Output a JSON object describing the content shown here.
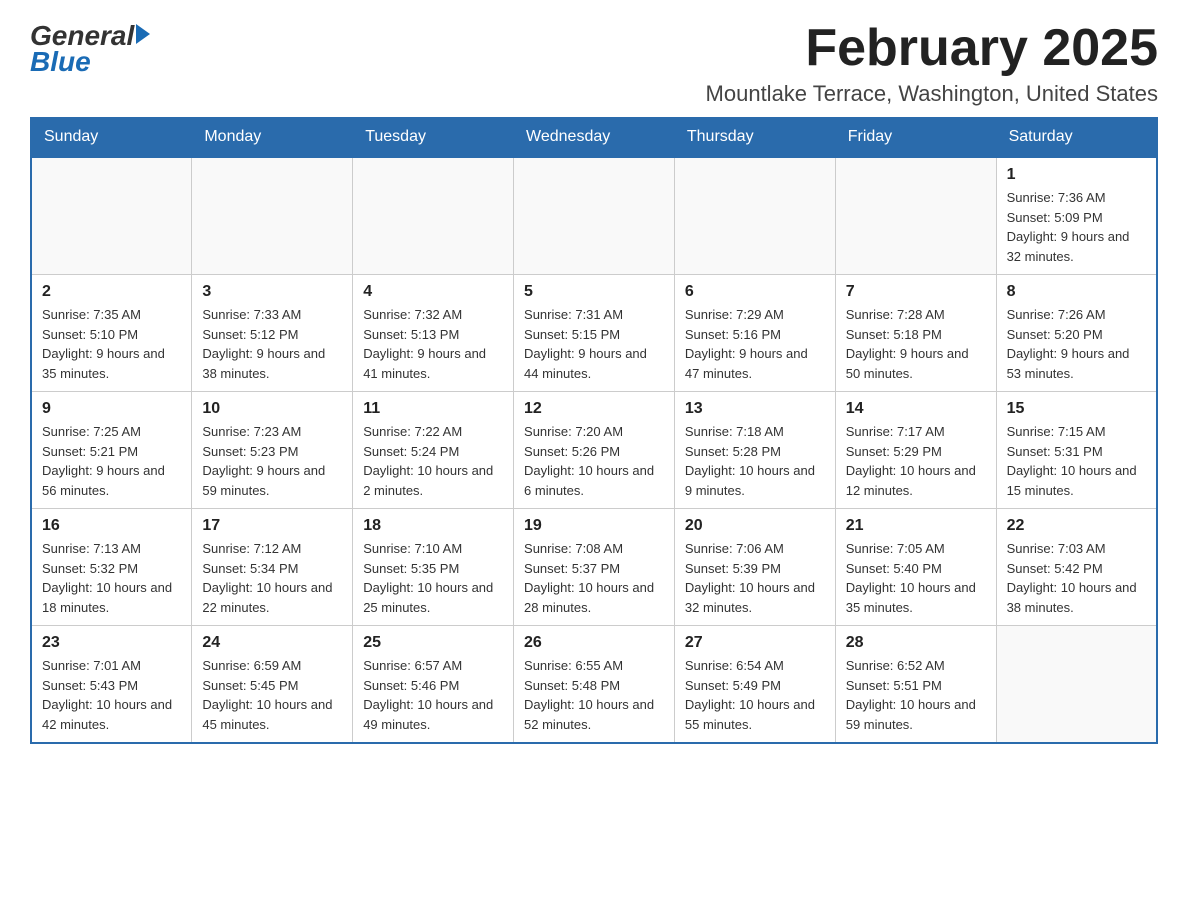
{
  "header": {
    "logo_general": "General",
    "logo_blue": "Blue",
    "month_title": "February 2025",
    "location": "Mountlake Terrace, Washington, United States"
  },
  "weekdays": [
    "Sunday",
    "Monday",
    "Tuesday",
    "Wednesday",
    "Thursday",
    "Friday",
    "Saturday"
  ],
  "weeks": [
    [
      {
        "day": "",
        "info": ""
      },
      {
        "day": "",
        "info": ""
      },
      {
        "day": "",
        "info": ""
      },
      {
        "day": "",
        "info": ""
      },
      {
        "day": "",
        "info": ""
      },
      {
        "day": "",
        "info": ""
      },
      {
        "day": "1",
        "info": "Sunrise: 7:36 AM\nSunset: 5:09 PM\nDaylight: 9 hours and 32 minutes."
      }
    ],
    [
      {
        "day": "2",
        "info": "Sunrise: 7:35 AM\nSunset: 5:10 PM\nDaylight: 9 hours and 35 minutes."
      },
      {
        "day": "3",
        "info": "Sunrise: 7:33 AM\nSunset: 5:12 PM\nDaylight: 9 hours and 38 minutes."
      },
      {
        "day": "4",
        "info": "Sunrise: 7:32 AM\nSunset: 5:13 PM\nDaylight: 9 hours and 41 minutes."
      },
      {
        "day": "5",
        "info": "Sunrise: 7:31 AM\nSunset: 5:15 PM\nDaylight: 9 hours and 44 minutes."
      },
      {
        "day": "6",
        "info": "Sunrise: 7:29 AM\nSunset: 5:16 PM\nDaylight: 9 hours and 47 minutes."
      },
      {
        "day": "7",
        "info": "Sunrise: 7:28 AM\nSunset: 5:18 PM\nDaylight: 9 hours and 50 minutes."
      },
      {
        "day": "8",
        "info": "Sunrise: 7:26 AM\nSunset: 5:20 PM\nDaylight: 9 hours and 53 minutes."
      }
    ],
    [
      {
        "day": "9",
        "info": "Sunrise: 7:25 AM\nSunset: 5:21 PM\nDaylight: 9 hours and 56 minutes."
      },
      {
        "day": "10",
        "info": "Sunrise: 7:23 AM\nSunset: 5:23 PM\nDaylight: 9 hours and 59 minutes."
      },
      {
        "day": "11",
        "info": "Sunrise: 7:22 AM\nSunset: 5:24 PM\nDaylight: 10 hours and 2 minutes."
      },
      {
        "day": "12",
        "info": "Sunrise: 7:20 AM\nSunset: 5:26 PM\nDaylight: 10 hours and 6 minutes."
      },
      {
        "day": "13",
        "info": "Sunrise: 7:18 AM\nSunset: 5:28 PM\nDaylight: 10 hours and 9 minutes."
      },
      {
        "day": "14",
        "info": "Sunrise: 7:17 AM\nSunset: 5:29 PM\nDaylight: 10 hours and 12 minutes."
      },
      {
        "day": "15",
        "info": "Sunrise: 7:15 AM\nSunset: 5:31 PM\nDaylight: 10 hours and 15 minutes."
      }
    ],
    [
      {
        "day": "16",
        "info": "Sunrise: 7:13 AM\nSunset: 5:32 PM\nDaylight: 10 hours and 18 minutes."
      },
      {
        "day": "17",
        "info": "Sunrise: 7:12 AM\nSunset: 5:34 PM\nDaylight: 10 hours and 22 minutes."
      },
      {
        "day": "18",
        "info": "Sunrise: 7:10 AM\nSunset: 5:35 PM\nDaylight: 10 hours and 25 minutes."
      },
      {
        "day": "19",
        "info": "Sunrise: 7:08 AM\nSunset: 5:37 PM\nDaylight: 10 hours and 28 minutes."
      },
      {
        "day": "20",
        "info": "Sunrise: 7:06 AM\nSunset: 5:39 PM\nDaylight: 10 hours and 32 minutes."
      },
      {
        "day": "21",
        "info": "Sunrise: 7:05 AM\nSunset: 5:40 PM\nDaylight: 10 hours and 35 minutes."
      },
      {
        "day": "22",
        "info": "Sunrise: 7:03 AM\nSunset: 5:42 PM\nDaylight: 10 hours and 38 minutes."
      }
    ],
    [
      {
        "day": "23",
        "info": "Sunrise: 7:01 AM\nSunset: 5:43 PM\nDaylight: 10 hours and 42 minutes."
      },
      {
        "day": "24",
        "info": "Sunrise: 6:59 AM\nSunset: 5:45 PM\nDaylight: 10 hours and 45 minutes."
      },
      {
        "day": "25",
        "info": "Sunrise: 6:57 AM\nSunset: 5:46 PM\nDaylight: 10 hours and 49 minutes."
      },
      {
        "day": "26",
        "info": "Sunrise: 6:55 AM\nSunset: 5:48 PM\nDaylight: 10 hours and 52 minutes."
      },
      {
        "day": "27",
        "info": "Sunrise: 6:54 AM\nSunset: 5:49 PM\nDaylight: 10 hours and 55 minutes."
      },
      {
        "day": "28",
        "info": "Sunrise: 6:52 AM\nSunset: 5:51 PM\nDaylight: 10 hours and 59 minutes."
      },
      {
        "day": "",
        "info": ""
      }
    ]
  ]
}
